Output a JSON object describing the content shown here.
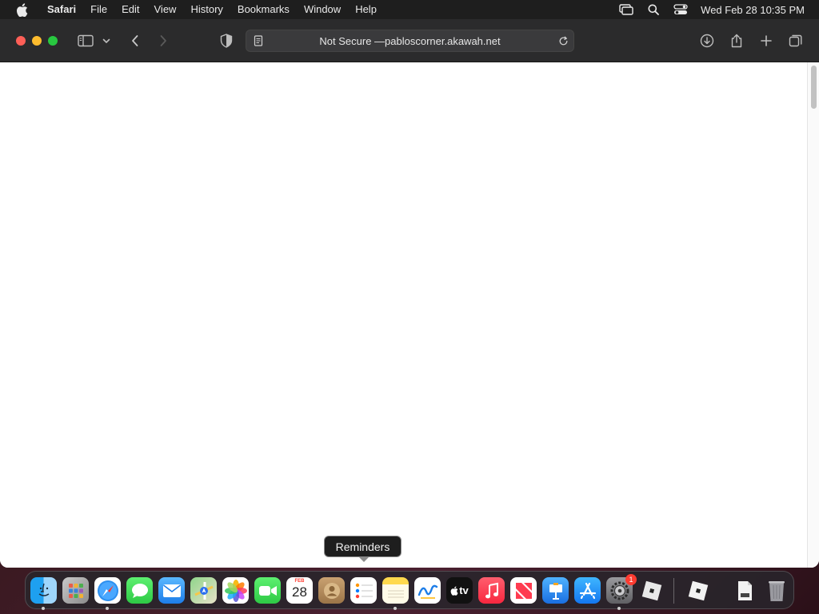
{
  "menubar": {
    "app_name": "Safari",
    "items": [
      "File",
      "Edit",
      "View",
      "History",
      "Bookmarks",
      "Window",
      "Help"
    ],
    "clock": "Wed Feb 28  10:35 PM"
  },
  "address_bar": {
    "prefix": "Not Secure — ",
    "domain": "pabloscorner.akawah.net"
  },
  "tooltip": {
    "text": "Reminders"
  },
  "dock": {
    "calendar_month": "FEB",
    "calendar_day": "28",
    "apple_tv_label": "tv",
    "settings_badge": "1"
  },
  "colors": {
    "close": "#fe5f57",
    "minimize": "#febc2e",
    "maximize": "#28c840",
    "badge": "#ff3b30"
  }
}
